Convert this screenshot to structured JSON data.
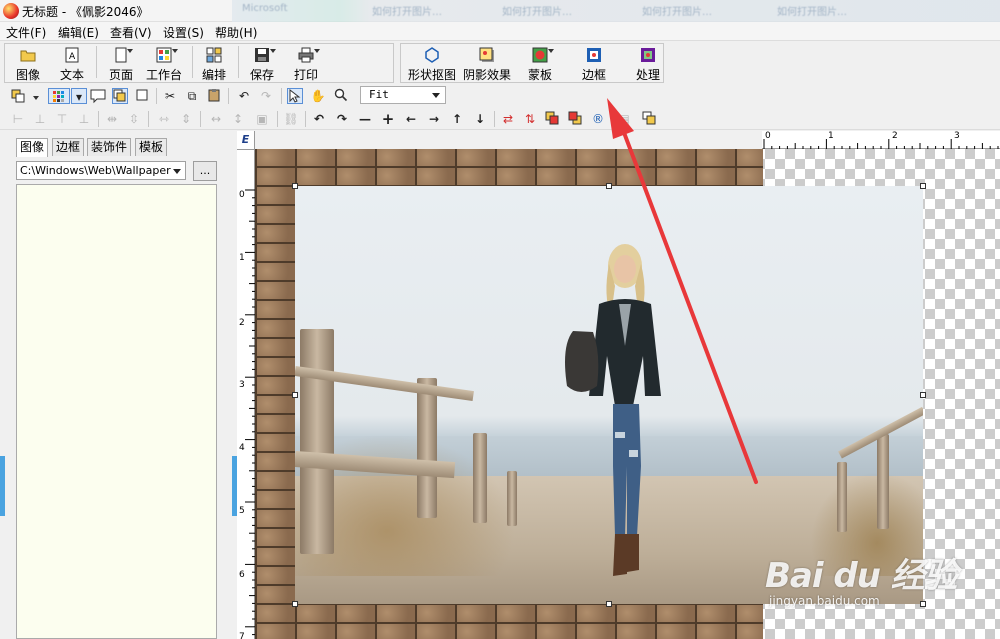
{
  "window": {
    "title": "无标题 - 《佩影2046》"
  },
  "browser_tabs": [
    "Microsoft",
    "如何打开图片…",
    "如何打开图片…",
    "如何打开图片…",
    "如何打开图片…"
  ],
  "menu": [
    "文件(F)",
    "编辑(E)",
    "查看(V)",
    "设置(S)",
    "帮助(H)"
  ],
  "toolbar_main": {
    "image": "图像",
    "text": "文本",
    "page": "页面",
    "workbench": "工作台",
    "layout": "编排",
    "save": "保存",
    "print": "打印",
    "shape_cutout": "形状抠图",
    "shadow": "阴影效果",
    "mask": "蒙板",
    "border": "边框",
    "process": "处理"
  },
  "zoom": {
    "value": "Fit"
  },
  "left_panel": {
    "tabs": [
      "图像",
      "边框",
      "装饰件",
      "模板"
    ],
    "path": "C:\\Windows\\Web\\Wallpaper",
    "browse_label": "..."
  },
  "rulers": {
    "horizontal": [
      "0",
      "1",
      "2",
      "3"
    ],
    "vertical": [
      "0",
      "1",
      "2",
      "3",
      "4",
      "5",
      "6",
      "7"
    ],
    "unit_glyph": "E"
  },
  "watermark": {
    "brand": "Bai du 经验",
    "url": "jingyan.baidu.com"
  },
  "colors": {
    "annotation_arrow": "#e8383a",
    "dock_handle": "#4aa3e0",
    "file_list_bg": "#fcfeef"
  }
}
